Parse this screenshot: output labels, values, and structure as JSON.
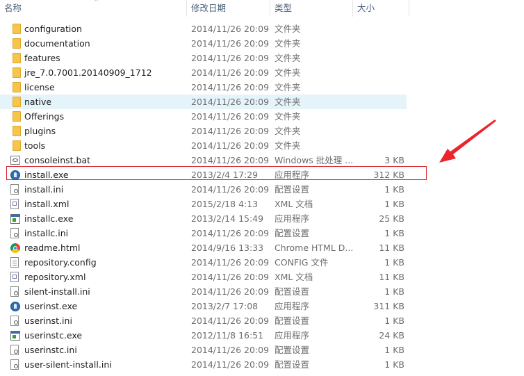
{
  "header": {
    "name": "名称",
    "date": "修改日期",
    "type": "类型",
    "size": "大小"
  },
  "files": [
    {
      "name": "configuration",
      "date": "2014/11/26 20:09",
      "type": "文件夹",
      "size": "",
      "icon": "folder-icon"
    },
    {
      "name": "documentation",
      "date": "2014/11/26 20:09",
      "type": "文件夹",
      "size": "",
      "icon": "folder-icon"
    },
    {
      "name": "features",
      "date": "2014/11/26 20:09",
      "type": "文件夹",
      "size": "",
      "icon": "folder-icon"
    },
    {
      "name": "jre_7.0.7001.20140909_1712",
      "date": "2014/11/26 20:09",
      "type": "文件夹",
      "size": "",
      "icon": "folder-icon"
    },
    {
      "name": "license",
      "date": "2014/11/26 20:09",
      "type": "文件夹",
      "size": "",
      "icon": "folder-icon"
    },
    {
      "name": "native",
      "date": "2014/11/26 20:09",
      "type": "文件夹",
      "size": "",
      "icon": "folder-icon"
    },
    {
      "name": "Offerings",
      "date": "2014/11/26 20:09",
      "type": "文件夹",
      "size": "",
      "icon": "folder-icon"
    },
    {
      "name": "plugins",
      "date": "2014/11/26 20:09",
      "type": "文件夹",
      "size": "",
      "icon": "folder-icon"
    },
    {
      "name": "tools",
      "date": "2014/11/26 20:09",
      "type": "文件夹",
      "size": "",
      "icon": "folder-icon"
    },
    {
      "name": "consoleinst.bat",
      "date": "2014/11/26 20:09",
      "type": "Windows 批处理 ...",
      "size": "3 KB",
      "icon": "batch-file-icon"
    },
    {
      "name": "install.exe",
      "date": "2013/2/4 17:29",
      "type": "应用程序",
      "size": "312 KB",
      "icon": "installer-app-icon"
    },
    {
      "name": "install.ini",
      "date": "2014/11/26 20:09",
      "type": "配置设置",
      "size": "1 KB",
      "icon": "config-file-icon"
    },
    {
      "name": "install.xml",
      "date": "2015/2/18 4:13",
      "type": "XML 文档",
      "size": "1 KB",
      "icon": "xml-file-icon"
    },
    {
      "name": "installc.exe",
      "date": "2013/2/14 15:49",
      "type": "应用程序",
      "size": "25 KB",
      "icon": "exe-file-icon"
    },
    {
      "name": "installc.ini",
      "date": "2014/11/26 20:09",
      "type": "配置设置",
      "size": "1 KB",
      "icon": "config-file-icon"
    },
    {
      "name": "readme.html",
      "date": "2014/9/16 13:33",
      "type": "Chrome HTML D...",
      "size": "11 KB",
      "icon": "chrome-icon"
    },
    {
      "name": "repository.config",
      "date": "2014/11/26 20:09",
      "type": "CONFIG 文件",
      "size": "1 KB",
      "icon": "document-icon"
    },
    {
      "name": "repository.xml",
      "date": "2014/11/26 20:09",
      "type": "XML 文档",
      "size": "11 KB",
      "icon": "xml-file-icon"
    },
    {
      "name": "silent-install.ini",
      "date": "2014/11/26 20:09",
      "type": "配置设置",
      "size": "1 KB",
      "icon": "config-file-icon"
    },
    {
      "name": "userinst.exe",
      "date": "2013/2/7 17:08",
      "type": "应用程序",
      "size": "311 KB",
      "icon": "installer-app-icon"
    },
    {
      "name": "userinst.ini",
      "date": "2014/11/26 20:09",
      "type": "配置设置",
      "size": "1 KB",
      "icon": "config-file-icon"
    },
    {
      "name": "userinstc.exe",
      "date": "2012/11/8 16:51",
      "type": "应用程序",
      "size": "24 KB",
      "icon": "exe-file-icon"
    },
    {
      "name": "userinstc.ini",
      "date": "2014/11/26 20:09",
      "type": "配置设置",
      "size": "1 KB",
      "icon": "config-file-icon"
    },
    {
      "name": "user-silent-install.ini",
      "date": "2014/11/26 20:09",
      "type": "配置设置",
      "size": "1 KB",
      "icon": "config-file-icon"
    }
  ],
  "highlighted_row": "native",
  "annotated_row": "install.exe",
  "colors": {
    "highlight": "#e5f3fb",
    "annotation": "#d9272e",
    "folder": "#f5c54c"
  }
}
